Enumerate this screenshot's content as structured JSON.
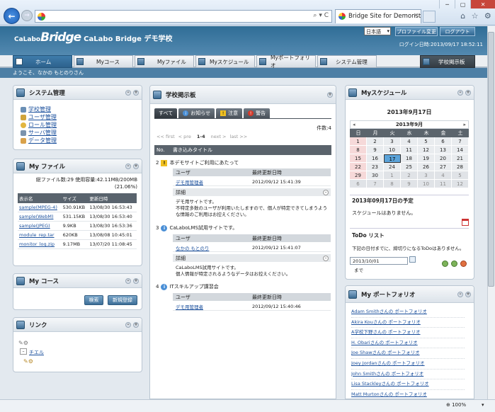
{
  "browser": {
    "tab_title": "Bridge Site for Demonst...",
    "tab_close": "×",
    "address_controls": "⌕ ▾ C",
    "window_controls": [
      "─",
      "▢",
      "✕"
    ],
    "icons": [
      "⌂",
      "☆",
      "⚙"
    ],
    "zoom": "⊕ 100%",
    "zoom_arrow": "▾"
  },
  "header": {
    "logo_small": "CaLabo",
    "logo_big": "Bridge",
    "site_name": "CaLabo Bridge デモ学校",
    "language": "日本語",
    "profile_button": "プロファイル変更",
    "logout_button": "ログアウト",
    "login_time": "ログイン日時:2013/09/17 18:52:11",
    "welcome": "ようこそ、なかの もとのりさん"
  },
  "menu": {
    "home": "ホーム",
    "course": "Myコース",
    "file": "Myファイル",
    "schedule": "Myスケジュール",
    "portfolio": "Myポートフォリオ",
    "system": "システム管理",
    "board": "学校掲示板"
  },
  "system": {
    "title": "システム管理",
    "items": [
      "学校管理",
      "ユーザ管理",
      "ロール管理",
      "サーバ管理",
      "データ管理"
    ]
  },
  "files": {
    "title": "My ファイル",
    "summary": "総ファイル数:29 使用容量:42.11MB/200MB",
    "percent": "(21.06%)",
    "headers": [
      "表示名",
      "サイズ",
      "更新日時"
    ],
    "rows": [
      [
        "sample(MPEG-4)",
        "530.91KB",
        "13/08/30 16:53:43"
      ],
      [
        "sample(WebM)",
        "531.15KB",
        "13/08/30 16:53:40"
      ],
      [
        "sample(JPEG)",
        "9.9KB",
        "13/08/30 16:53:36"
      ],
      [
        "module_rep.tar",
        "620KB",
        "13/08/08 10:45:01"
      ],
      [
        "monitor_log.zip",
        "9.17MB",
        "13/07/20 11:08:45"
      ]
    ]
  },
  "course": {
    "title": "My コース",
    "search_button": "検索",
    "new_button": "新規登録"
  },
  "links": {
    "title": "リンク",
    "item": "チエル"
  },
  "board": {
    "title": "学校掲示板",
    "tabs": [
      "すべて",
      "お知らせ",
      "注意",
      "警告"
    ],
    "count": "件数:4",
    "pager_first": "<< first",
    "pager_prev": "< pre",
    "pager_current": "1-4",
    "pager_next": "next >",
    "pager_last": "last >>",
    "col_no": "No.",
    "col_title": "書き込みタイトル",
    "col_user": "ユーザ",
    "col_updated": "最終更新日時",
    "detail_label": "詳細",
    "posts": [
      {
        "no": "2",
        "title": "本デモサイトご利用にあたって",
        "user": "デモ用管理者",
        "updated": "2012/09/12 15:41:39",
        "detail": "デモ用サイトです。\n不特定多数のユーザが利用いたしますので、個人が特定できてしまうような情報のご利用はお控えください。"
      },
      {
        "no": "3",
        "title": "CaLaboLMS試用サイトです。",
        "user": "なかの もとのり",
        "updated": "2012/09/12 15:41:07",
        "detail": "CaLaboLMS試用サイトです。\n個人情報が特定されるようなデータはお控えください。"
      },
      {
        "no": "4",
        "title": "ITスキルアップ講習会",
        "user": "デモ用管理者",
        "updated": "2012/09/12 15:40:46"
      }
    ]
  },
  "schedule": {
    "title": "Myスケジュール",
    "date_label": "2013年9月17日",
    "month": "2013年9月",
    "weekdays": [
      "日",
      "月",
      "火",
      "水",
      "木",
      "金",
      "土"
    ],
    "weeks": [
      [
        "1",
        "2",
        "3",
        "4",
        "5",
        "6",
        "7"
      ],
      [
        "8",
        "9",
        "10",
        "11",
        "12",
        "13",
        "14"
      ],
      [
        "15",
        "16",
        "17",
        "18",
        "19",
        "20",
        "21"
      ],
      [
        "22",
        "23",
        "24",
        "25",
        "26",
        "27",
        "28"
      ],
      [
        "29",
        "30",
        "1",
        "2",
        "3",
        "4",
        "5"
      ],
      [
        "6",
        "7",
        "8",
        "9",
        "10",
        "11",
        "12"
      ]
    ],
    "today": "17",
    "day_title": "2013年09月17日の予定",
    "no_schedule": "スケジュールはありません。",
    "todo_title": "ToDo リスト",
    "todo_text": "下記の日付までに、締切りになるToDoはありません。",
    "todo_date": "2013/10/01",
    "todo_until": "まで"
  },
  "portfolio": {
    "title": "My ポートフォリオ",
    "items": [
      "Adam Smithさんの ポートフォリオ",
      "Akira Kouさんの ポートフォリオ",
      "A学校下野さんの ポートフォリオ",
      "H. Obariさんの ポートフォリオ",
      "Joe Shawさんの ポートフォリオ",
      "Joey Jordanさんの ポートフォリオ",
      "John Smithさんの ポートフォリオ",
      "Lisa Stackleyさんの ポートフォリオ",
      "Matt Murtonさんの ポートフォリオ"
    ]
  },
  "colors": {
    "header": "#3a76a0",
    "accent": "#2d628d",
    "today": "#5ba3d9"
  }
}
